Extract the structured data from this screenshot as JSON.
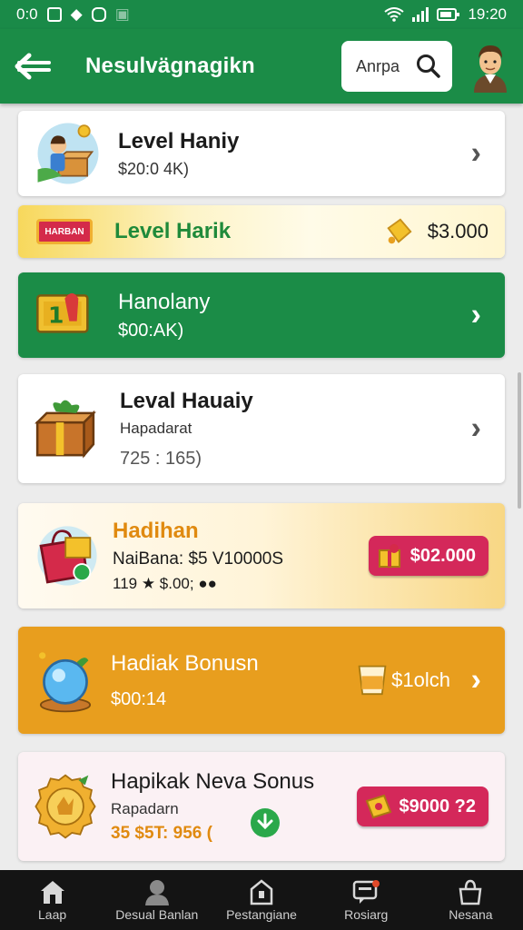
{
  "status": {
    "time_left": "0:0",
    "time_right": "19:20"
  },
  "header": {
    "title": "Nesulvägnagikn",
    "search_placeholder": "Anrpa"
  },
  "cards": [
    {
      "name": "Level Haniy",
      "sub": "$20:0 4K)"
    },
    {
      "name": "Level Harik",
      "value": "$3.000",
      "tag": "HARBAN"
    },
    {
      "name": "Hanolany",
      "sub": "$00:AK)"
    },
    {
      "name": "Leval Hauaiy",
      "sub": "Hapadarat",
      "sub2": "725 : 165)"
    },
    {
      "name": "Hadihan",
      "sub": "NaiBana: $5 V10000S",
      "sub2": "119 ★ $.00; ●●",
      "pill": "$02.000"
    },
    {
      "name": "Hadiak Bonusn",
      "sub": "$00:14",
      "pill": "$1olch"
    },
    {
      "name": "Hapikak Neva Sonus",
      "sub": "Rapadarn",
      "sub2": "35 $5T: 956 (",
      "pill": "$9000 ?2"
    }
  ],
  "nav": [
    {
      "label": "Laap",
      "icon": "home-icon"
    },
    {
      "label": "Desual Banlan",
      "icon": "person-icon"
    },
    {
      "label": "Pestangiane",
      "icon": "house-icon"
    },
    {
      "label": "Rosiarg",
      "icon": "chat-icon"
    },
    {
      "label": "Nesana",
      "icon": "bag-icon"
    }
  ],
  "colors": {
    "brand": "#1b8c47",
    "orange": "#e8a020",
    "pink": "#d4285a"
  }
}
